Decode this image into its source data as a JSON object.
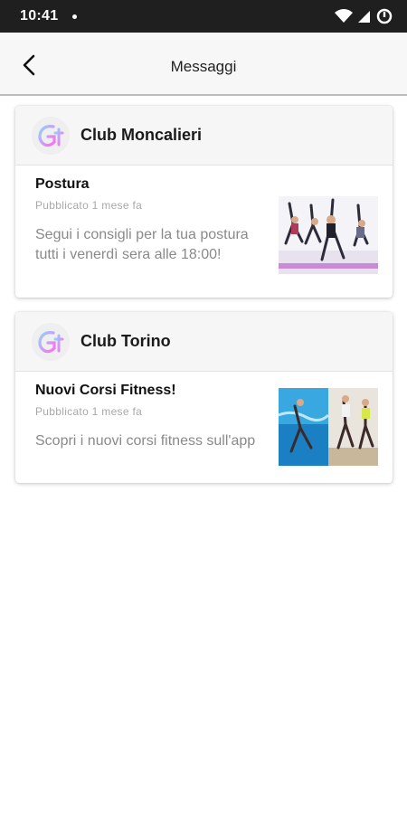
{
  "status_bar": {
    "time": "10:41"
  },
  "app_bar": {
    "title": "Messaggi"
  },
  "messages": [
    {
      "club": "Club Moncalieri",
      "title": "Postura",
      "date": "Pubblicato 1 mese fa",
      "text": "Segui i consigli per la tua postura tutti i venerdì sera alle 18:00!"
    },
    {
      "club": "Club Torino",
      "title": "Nuovi Corsi Fitness!",
      "date": "Pubblicato 1 mese fa",
      "text": "Scopri i nuovi corsi fitness sull'app"
    }
  ],
  "colors": {
    "status_bar": "#1f1f1f",
    "app_bar": "#f7f7f7",
    "logo_gradient_start": "#8fd3ff",
    "logo_gradient_end": "#ff6df0"
  }
}
